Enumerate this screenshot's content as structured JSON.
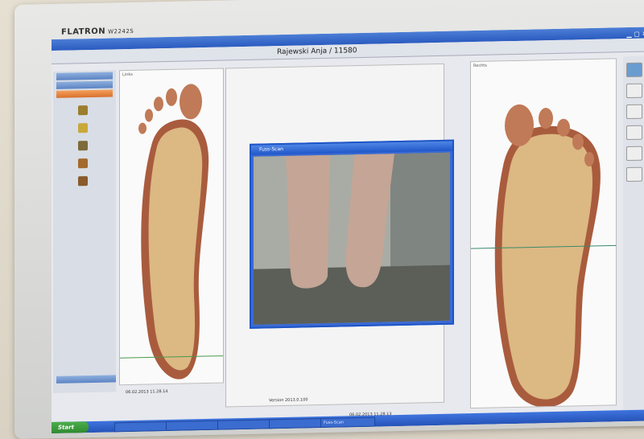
{
  "monitor": {
    "brand": "FLATRON",
    "model": "W2242S"
  },
  "app": {
    "window_title": "",
    "patient": "Rajewski Anja / 11580"
  },
  "nav": {
    "items": [
      "",
      "",
      ""
    ],
    "icons": [
      {
        "name": "",
        "icon": "foot-icon"
      },
      {
        "name": "",
        "icon": "figure-icon"
      },
      {
        "name": "",
        "icon": "tool-icon"
      },
      {
        "name": "",
        "icon": "edit-icon"
      },
      {
        "name": "",
        "icon": "settings-icon"
      }
    ],
    "bottom_button": ""
  },
  "panes": {
    "left_label": "Links",
    "right_label": "Rechts"
  },
  "scan_window": {
    "title": "Fuss-Scan"
  },
  "status": {
    "left_date": "06.02.2013 11.28.14",
    "version": "Version 2013.0.100",
    "right_date": "06.02.2013 11.28.13"
  },
  "taskbar": {
    "start": "Start",
    "tasks": [
      "",
      "",
      "",
      "",
      "Fuss-Scan"
    ]
  },
  "colors": {
    "titlebar": "#2a5bc0",
    "active_nav": "#d9702d",
    "sole": "#d8b07a",
    "sole_edge": "#a55a3c"
  }
}
